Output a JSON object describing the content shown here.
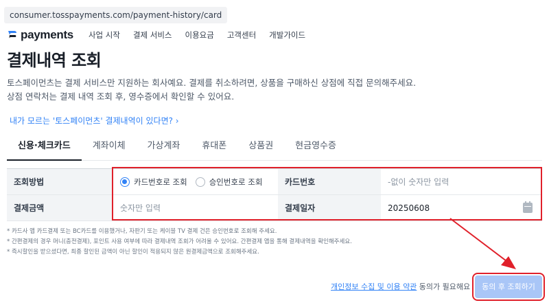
{
  "url": "consumer.tosspayments.com/payment-history/card",
  "brand": {
    "name": "payments",
    "color": "#3182f6"
  },
  "nav": {
    "items": [
      "사업 시작",
      "결제 서비스",
      "이용요금",
      "고객센터",
      "개발가이드"
    ]
  },
  "page": {
    "title": "결제내역 조회",
    "desc1": "토스페이먼츠는 결제 서비스만 지원하는 회사예요. 결제를 취소하려면, 상품을 구매하신 상점에 직접 문의해주세요.",
    "desc2": "상점 연락처는 결제 내역 조회 후, 영수증에서 확인할 수 있어요.",
    "help_link": "내가 모르는 '토스페이먼츠' 결제내역이 있다면? ›"
  },
  "tabs": [
    {
      "label": "신용·체크카드",
      "active": true
    },
    {
      "label": "계좌이체",
      "active": false
    },
    {
      "label": "가상계좌",
      "active": false
    },
    {
      "label": "휴대폰",
      "active": false
    },
    {
      "label": "상품권",
      "active": false
    },
    {
      "label": "현금영수증",
      "active": false
    }
  ],
  "form": {
    "method_label": "조회방법",
    "method_options": [
      {
        "label": "카드번호로 조회",
        "selected": true
      },
      {
        "label": "승인번호로 조회",
        "selected": false
      }
    ],
    "card_label": "카드번호",
    "card_placeholder": "-없이 숫자만 입력",
    "amount_label": "결제금액",
    "amount_placeholder": "숫자만 입력",
    "date_label": "결제일자",
    "date_value": "20250608"
  },
  "notes": [
    "* 카드사 앱 카드결제 또는 BC카드를 이용했거나, 자판기 또는 케이블 TV 결제 건은 승인번호로 조회해 주세요.",
    "* 간편결제의 경우 머니(충전결제), 포인트 사용 여부에 따라 결제내역 조회가 어려울 수 있어요. 간편결제 앱을 통해 결제내역을 확인해주세요.",
    "* 즉시할인을 받으셨다면, 최종 할인된 금액이 아닌 할인이 적용되지 않은 원결제금액으로 조회해주세요."
  ],
  "agree": {
    "link": "개인정보 수집 및 이용 약관",
    "text": " 동의가 필요해요"
  },
  "submit_label": "동의 후 조회하기",
  "colors": {
    "primary": "#3182f6",
    "highlight": "#e0202a",
    "button_disabled": "#a9c6f7"
  }
}
